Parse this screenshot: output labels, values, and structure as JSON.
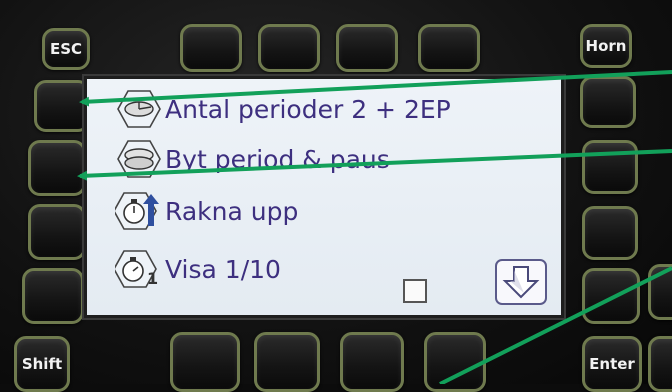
{
  "keys": {
    "esc": "ESC",
    "horn": "Horn",
    "shift": "Shift",
    "enter": "Enter"
  },
  "menu": [
    {
      "label": "Antal perioder 2 + 2EP",
      "icon": "period-disc-icon"
    },
    {
      "label": "Byt period & paus",
      "icon": "period-swap-icon"
    },
    {
      "label": "Rakna upp",
      "icon": "stopwatch-count-up-icon"
    },
    {
      "label": "Visa 1/10",
      "icon": "stopwatch-tenths-icon"
    }
  ],
  "show_tenths_checked": false,
  "colors": {
    "key_border": "#6f7a4e",
    "screen_bg": "#eef3f8",
    "menu_text": "#3d2f7f",
    "annotation_arrow": "#12a05a"
  }
}
